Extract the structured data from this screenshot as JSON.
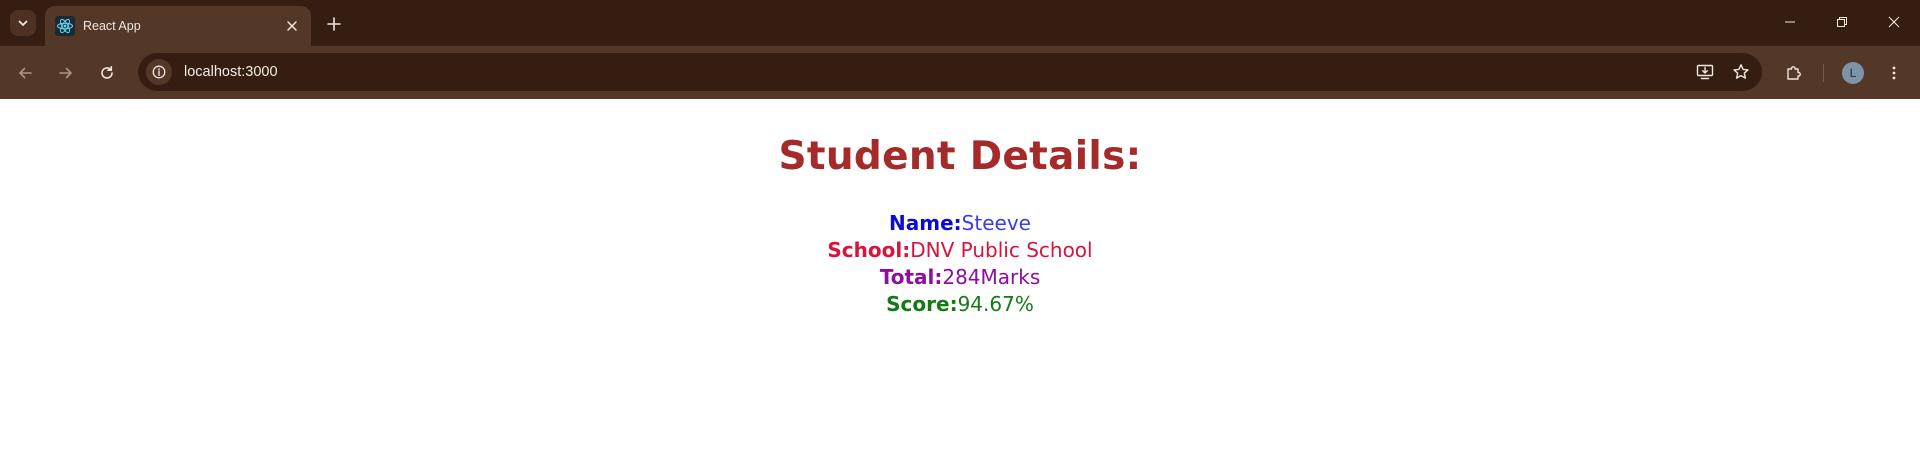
{
  "browser": {
    "tab": {
      "title": "React App"
    },
    "address_bar": {
      "url": "localhost:3000"
    },
    "profile_initial": "L",
    "icons": {
      "tab_search": "chevron-down-icon",
      "favicon": "react-logo-icon",
      "tab_close": "close-icon",
      "new_tab": "plus-icon",
      "back": "arrow-left-icon",
      "forward": "arrow-right-icon",
      "reload": "reload-icon",
      "site_info": "info-icon",
      "install": "install-app-icon",
      "bookmark": "star-icon",
      "extensions": "puzzle-icon",
      "menu": "kebab-menu-icon"
    },
    "colors": {
      "frame": "#351e11",
      "toolbar": "#533828"
    }
  },
  "page": {
    "title": "Student Details:",
    "fields": [
      {
        "label": "Name:",
        "value": "Steeve",
        "color": "#0b0bd6"
      },
      {
        "label": "School:",
        "value": "DNV Public School",
        "color": "#d6143c"
      },
      {
        "label": "Total:",
        "value": "284Marks",
        "color": "#8b0fa0"
      },
      {
        "label": "Score:",
        "value": "94.67%",
        "color": "#157a15"
      }
    ],
    "title_color": "#a52a2a"
  }
}
